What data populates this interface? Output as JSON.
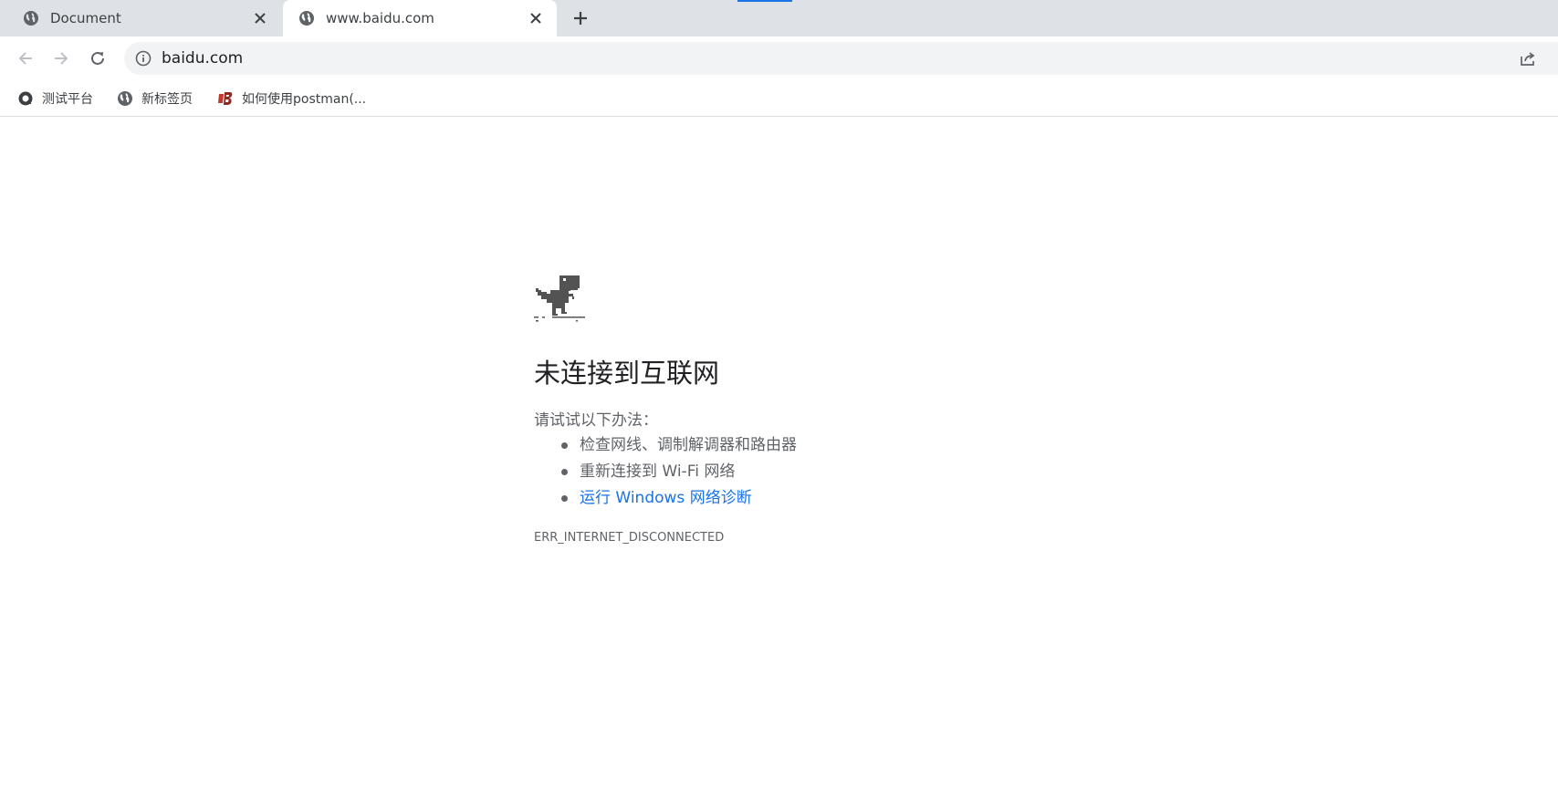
{
  "tabs": [
    {
      "title": "Document",
      "active": false,
      "icon": "globe-icon"
    },
    {
      "title": "www.baidu.com",
      "active": true,
      "icon": "globe-icon"
    }
  ],
  "omnibox": {
    "url": "baidu.com",
    "icon": "info-icon"
  },
  "bookmarks": [
    {
      "label": "测试平台",
      "icon": "circle-logo-icon"
    },
    {
      "label": "新标签页",
      "icon": "globe-icon"
    },
    {
      "label": "如何使用postman(...",
      "icon": "b-logo-icon"
    }
  ],
  "error": {
    "title": "未连接到互联网",
    "suggestions_intro": "请试试以下办法：",
    "suggestions": [
      "检查网线、调制解调器和路由器",
      "重新连接到 Wi-Fi 网络",
      "运行 Windows 网络诊断"
    ],
    "code": "ERR_INTERNET_DISCONNECTED"
  },
  "colors": {
    "tabstrip_bg": "#dee1e6",
    "omnibox_bg": "#f1f3f4",
    "link": "#1a73e8",
    "text_secondary": "#5f6368"
  }
}
